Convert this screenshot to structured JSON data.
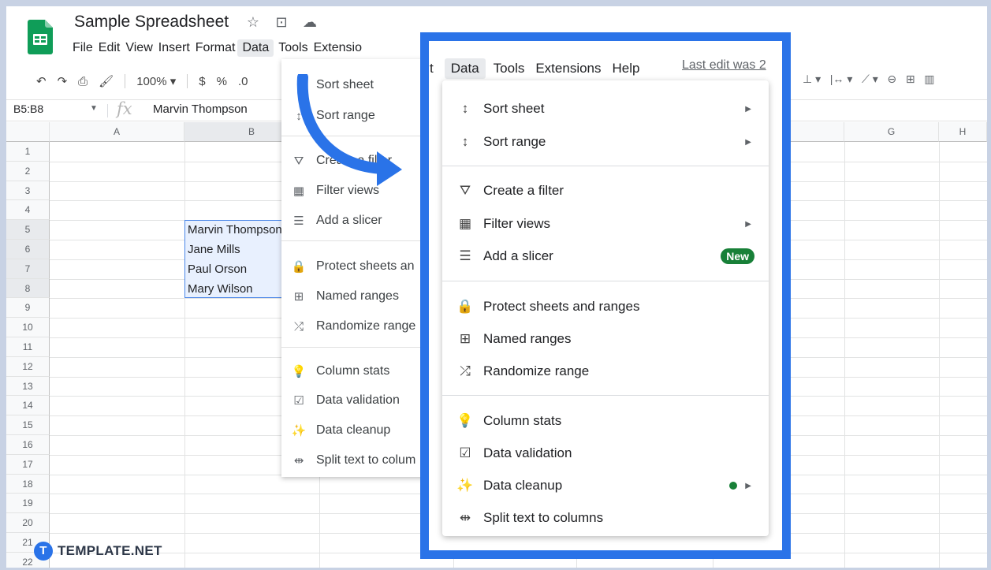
{
  "doc": {
    "title": "Sample Spreadsheet",
    "star_icon": "☆",
    "move_icon": "⊡",
    "cloud_icon": "☁"
  },
  "menubar": [
    "File",
    "Edit",
    "View",
    "Insert",
    "Format",
    "Data",
    "Tools",
    "Extensio"
  ],
  "toolbar": {
    "zoom": "100%",
    "currency": "$",
    "percent": "%",
    "decimal": ".0"
  },
  "formula_bar": {
    "cell_ref": "B5:B8",
    "fx": "fx",
    "content": "Marvin Thompson"
  },
  "columns": [
    {
      "label": "",
      "w": 55
    },
    {
      "label": "A",
      "w": 171
    },
    {
      "label": "B",
      "w": 171
    },
    {
      "label": "",
      "w": 170
    },
    {
      "label": "",
      "w": 156
    },
    {
      "label": "",
      "w": 173
    },
    {
      "label": "",
      "w": 167
    },
    {
      "label": "G",
      "w": 120
    },
    {
      "label": "H",
      "w": 61
    }
  ],
  "rows": [
    "1",
    "2",
    "3",
    "4",
    "5",
    "6",
    "7",
    "8",
    "9",
    "10",
    "11",
    "12",
    "13",
    "14",
    "15",
    "16",
    "17",
    "18",
    "19",
    "20",
    "21",
    "22"
  ],
  "cells": [
    "Marvin Thompson",
    "Jane Mills",
    "Paul Orson",
    "Mary Wilson"
  ],
  "menu_small": {
    "items": [
      {
        "icon": "↕",
        "label": "Sort sheet"
      },
      {
        "icon": "↕",
        "label": "Sort range"
      },
      {
        "icon": "⛛",
        "label": "Create a filter"
      },
      {
        "icon": "▦",
        "label": "Filter views"
      },
      {
        "icon": "☰",
        "label": "Add a slicer"
      },
      {
        "icon": "🔒",
        "label": "Protect sheets an"
      },
      {
        "icon": "⊞",
        "label": "Named ranges"
      },
      {
        "icon": "⤮",
        "label": "Randomize range"
      },
      {
        "icon": "💡",
        "label": "Column stats"
      },
      {
        "icon": "☑",
        "label": "Data validation"
      },
      {
        "icon": "✨",
        "label": "Data cleanup"
      },
      {
        "icon": "⇹",
        "label": "Split text to colum"
      }
    ]
  },
  "zoom_menu": {
    "bar": [
      "t",
      "Data",
      "Tools",
      "Extensions",
      "Help"
    ],
    "last_edit": "Last edit was 2",
    "items": [
      {
        "icon": "↕",
        "label": "Sort sheet",
        "arrow": "▶"
      },
      {
        "icon": "↕",
        "label": "Sort range",
        "arrow": "▶"
      },
      {
        "icon": "⛛",
        "label": "Create a filter"
      },
      {
        "icon": "▦",
        "label": "Filter views",
        "arrow": "▶"
      },
      {
        "icon": "☰",
        "label": "Add a slicer",
        "badge": "New"
      },
      {
        "icon": "🔒",
        "label": "Protect sheets and ranges"
      },
      {
        "icon": "⊞",
        "label": "Named ranges"
      },
      {
        "icon": "⤮",
        "label": "Randomize range"
      },
      {
        "icon": "💡",
        "label": "Column stats"
      },
      {
        "icon": "☑",
        "label": "Data validation"
      },
      {
        "icon": "✨",
        "label": "Data cleanup",
        "dot": true,
        "arrow": "▶"
      },
      {
        "icon": "⇹",
        "label": "Split text to columns"
      }
    ]
  },
  "watermark": {
    "logo": "T",
    "text": "TEMPLATE.NET"
  },
  "colors": {
    "accent": "#2a73e8",
    "green": "#188038",
    "sheets_green": "#0f9d58"
  }
}
